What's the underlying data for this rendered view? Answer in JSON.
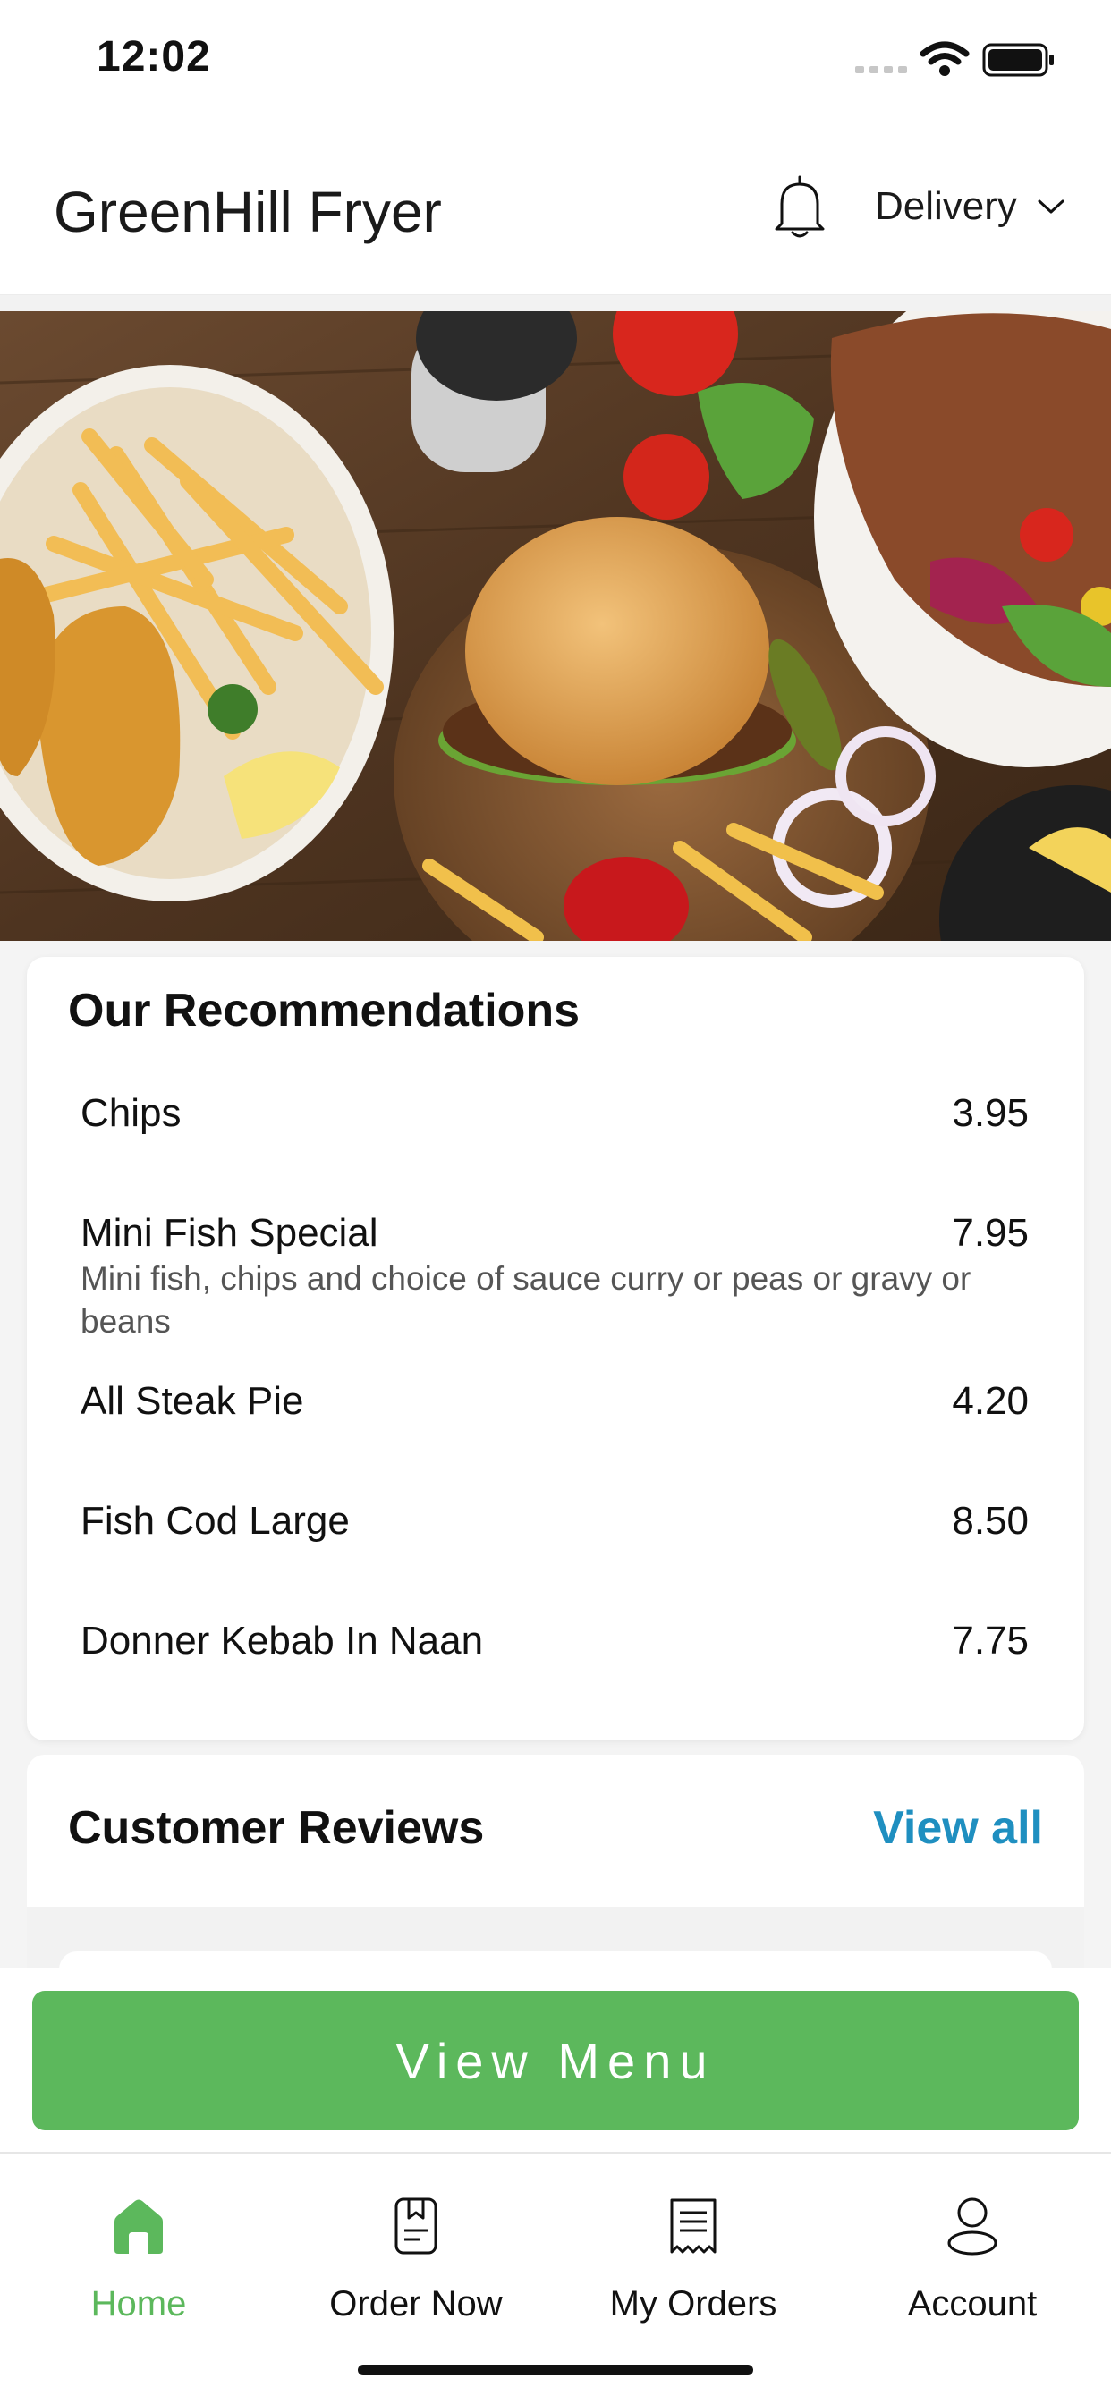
{
  "status_bar": {
    "time": "12:02"
  },
  "header": {
    "title": "GreenHill Fryer",
    "delivery_label": "Delivery",
    "icons": {
      "notifications": "bell-icon",
      "dropdown": "chevron-down-icon"
    }
  },
  "hero": {
    "image": "food-platter-photo"
  },
  "recommendations": {
    "title": "Our Recommendations",
    "items": [
      {
        "name": "Chips",
        "price": "3.95",
        "description": ""
      },
      {
        "name": "Mini Fish Special",
        "price": "7.95",
        "description": "Mini fish, chips and choice of sauce curry or peas or gravy or beans"
      },
      {
        "name": "All Steak Pie",
        "price": "4.20",
        "description": ""
      },
      {
        "name": "Fish Cod Large",
        "price": "8.50",
        "description": ""
      },
      {
        "name": "Donner Kebab In Naan",
        "price": "7.75",
        "description": ""
      }
    ]
  },
  "reviews": {
    "title": "Customer Reviews",
    "view_all": "View all"
  },
  "view_menu_button": "View Menu",
  "tab_bar": {
    "active": "Home",
    "tabs": [
      {
        "label": "Home",
        "icon": "home-icon"
      },
      {
        "label": "Order Now",
        "icon": "order-icon"
      },
      {
        "label": "My Orders",
        "icon": "receipt-icon"
      },
      {
        "label": "Account",
        "icon": "user-icon"
      }
    ]
  },
  "colors": {
    "accent_green": "#5cb85c",
    "link_blue": "#1f8fc0",
    "text": "#111111"
  }
}
